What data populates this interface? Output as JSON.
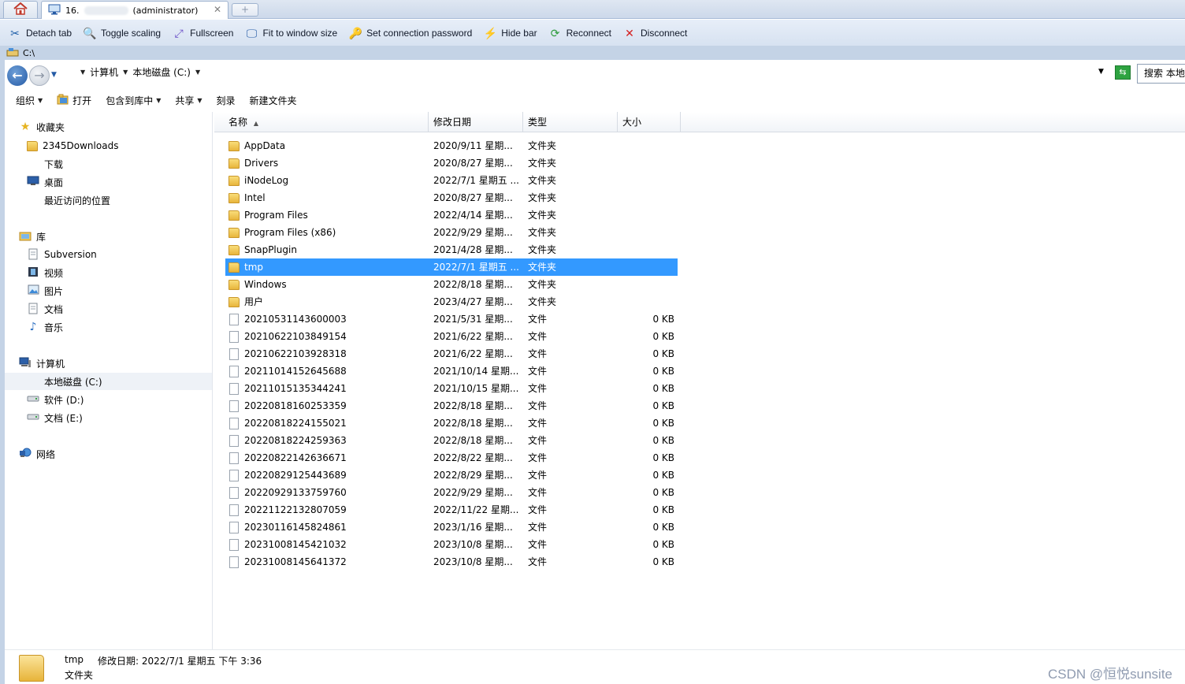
{
  "tabs": {
    "home_icon": "home-icon",
    "connection_tab": {
      "ip_prefix": "16.",
      "user": "(administrator)",
      "close": "✕"
    },
    "new_tab": "+"
  },
  "conn_toolbar": [
    {
      "label": "Detach tab",
      "icon": "scissors-icon",
      "glyph": "✂",
      "color": "#1f5fa8"
    },
    {
      "label": "Toggle scaling",
      "icon": "magnifier-icon",
      "glyph": "🔍",
      "color": "#245aa5"
    },
    {
      "label": "Fullscreen",
      "icon": "fullscreen-icon",
      "glyph": "⤢",
      "color": "#6b4fc8"
    },
    {
      "label": "Fit to window size",
      "icon": "fit-window-icon",
      "glyph": "🖵",
      "color": "#245aa5"
    },
    {
      "label": "Set connection password",
      "icon": "key-icon",
      "glyph": "🔑",
      "color": "#d99a1c"
    },
    {
      "label": "Hide bar",
      "icon": "lightning-icon",
      "glyph": "⚡",
      "color": "#7d3cd8"
    },
    {
      "label": "Reconnect",
      "icon": "reconnect-icon",
      "glyph": "⟳",
      "color": "#2e9c3e"
    },
    {
      "label": "Disconnect",
      "icon": "disconnect-icon",
      "glyph": "✕",
      "color": "#d42020"
    }
  ],
  "remote_title": "C:\\",
  "address": {
    "crumbs": [
      "计算机",
      "本地磁盘 (C:)"
    ],
    "search_placeholder": "搜索 本地"
  },
  "commands": [
    "组织",
    "打开",
    "包含到库中",
    "共享",
    "刻录",
    "新建文件夹"
  ],
  "nav": {
    "favorites": {
      "label": "收藏夹",
      "items": [
        "2345Downloads",
        "下载",
        "桌面",
        "最近访问的位置"
      ]
    },
    "libraries": {
      "label": "库",
      "items": [
        "Subversion",
        "视频",
        "图片",
        "文档",
        "音乐"
      ]
    },
    "computer": {
      "label": "计算机",
      "items": [
        "本地磁盘 (C:)",
        "软件 (D:)",
        "文档 (E:)"
      ]
    },
    "network": {
      "label": "网络"
    }
  },
  "columns": {
    "name": "名称",
    "date": "修改日期",
    "type": "类型",
    "size": "大小"
  },
  "files": [
    {
      "name": "AppData",
      "date": "2020/9/11 星期...",
      "type": "文件夹",
      "size": "",
      "kind": "folder"
    },
    {
      "name": "Drivers",
      "date": "2020/8/27 星期...",
      "type": "文件夹",
      "size": "",
      "kind": "folder"
    },
    {
      "name": "iNodeLog",
      "date": "2022/7/1 星期五 ...",
      "type": "文件夹",
      "size": "",
      "kind": "folder"
    },
    {
      "name": "Intel",
      "date": "2020/8/27 星期...",
      "type": "文件夹",
      "size": "",
      "kind": "folder"
    },
    {
      "name": "Program Files",
      "date": "2022/4/14 星期...",
      "type": "文件夹",
      "size": "",
      "kind": "folder"
    },
    {
      "name": "Program Files (x86)",
      "date": "2022/9/29 星期...",
      "type": "文件夹",
      "size": "",
      "kind": "folder"
    },
    {
      "name": "SnapPlugin",
      "date": "2021/4/28 星期...",
      "type": "文件夹",
      "size": "",
      "kind": "folder"
    },
    {
      "name": "tmp",
      "date": "2022/7/1 星期五 ...",
      "type": "文件夹",
      "size": "",
      "kind": "folder",
      "selected": true
    },
    {
      "name": "Windows",
      "date": "2022/8/18 星期...",
      "type": "文件夹",
      "size": "",
      "kind": "folder"
    },
    {
      "name": "用户",
      "date": "2023/4/27 星期...",
      "type": "文件夹",
      "size": "",
      "kind": "folder"
    },
    {
      "name": "20210531143600003",
      "date": "2021/5/31 星期...",
      "type": "文件",
      "size": "0 KB",
      "kind": "file"
    },
    {
      "name": "20210622103849154",
      "date": "2021/6/22 星期...",
      "type": "文件",
      "size": "0 KB",
      "kind": "file"
    },
    {
      "name": "20210622103928318",
      "date": "2021/6/22 星期...",
      "type": "文件",
      "size": "0 KB",
      "kind": "file"
    },
    {
      "name": "20211014152645688",
      "date": "2021/10/14 星期...",
      "type": "文件",
      "size": "0 KB",
      "kind": "file"
    },
    {
      "name": "20211015135344241",
      "date": "2021/10/15 星期...",
      "type": "文件",
      "size": "0 KB",
      "kind": "file"
    },
    {
      "name": "20220818160253359",
      "date": "2022/8/18 星期...",
      "type": "文件",
      "size": "0 KB",
      "kind": "file"
    },
    {
      "name": "20220818224155021",
      "date": "2022/8/18 星期...",
      "type": "文件",
      "size": "0 KB",
      "kind": "file"
    },
    {
      "name": "20220818224259363",
      "date": "2022/8/18 星期...",
      "type": "文件",
      "size": "0 KB",
      "kind": "file"
    },
    {
      "name": "20220822142636671",
      "date": "2022/8/22 星期...",
      "type": "文件",
      "size": "0 KB",
      "kind": "file"
    },
    {
      "name": "20220829125443689",
      "date": "2022/8/29 星期...",
      "type": "文件",
      "size": "0 KB",
      "kind": "file"
    },
    {
      "name": "20220929133759760",
      "date": "2022/9/29 星期...",
      "type": "文件",
      "size": "0 KB",
      "kind": "file"
    },
    {
      "name": "20221122132807059",
      "date": "2022/11/22 星期...",
      "type": "文件",
      "size": "0 KB",
      "kind": "file"
    },
    {
      "name": "20230116145824861",
      "date": "2023/1/16 星期...",
      "type": "文件",
      "size": "0 KB",
      "kind": "file"
    },
    {
      "name": "20231008145421032",
      "date": "2023/10/8 星期...",
      "type": "文件",
      "size": "0 KB",
      "kind": "file"
    },
    {
      "name": "20231008145641372",
      "date": "2023/10/8 星期...",
      "type": "文件",
      "size": "0 KB",
      "kind": "file"
    }
  ],
  "details": {
    "name": "tmp",
    "modified": "修改日期: 2022/7/1 星期五 下午 3:36",
    "type": "文件夹"
  },
  "watermark": "CSDN @恒悦sunsite",
  "colors": {
    "selection": "#3399ff",
    "toolbar_bg": "#dde6f2",
    "accent": "#245aa5"
  }
}
